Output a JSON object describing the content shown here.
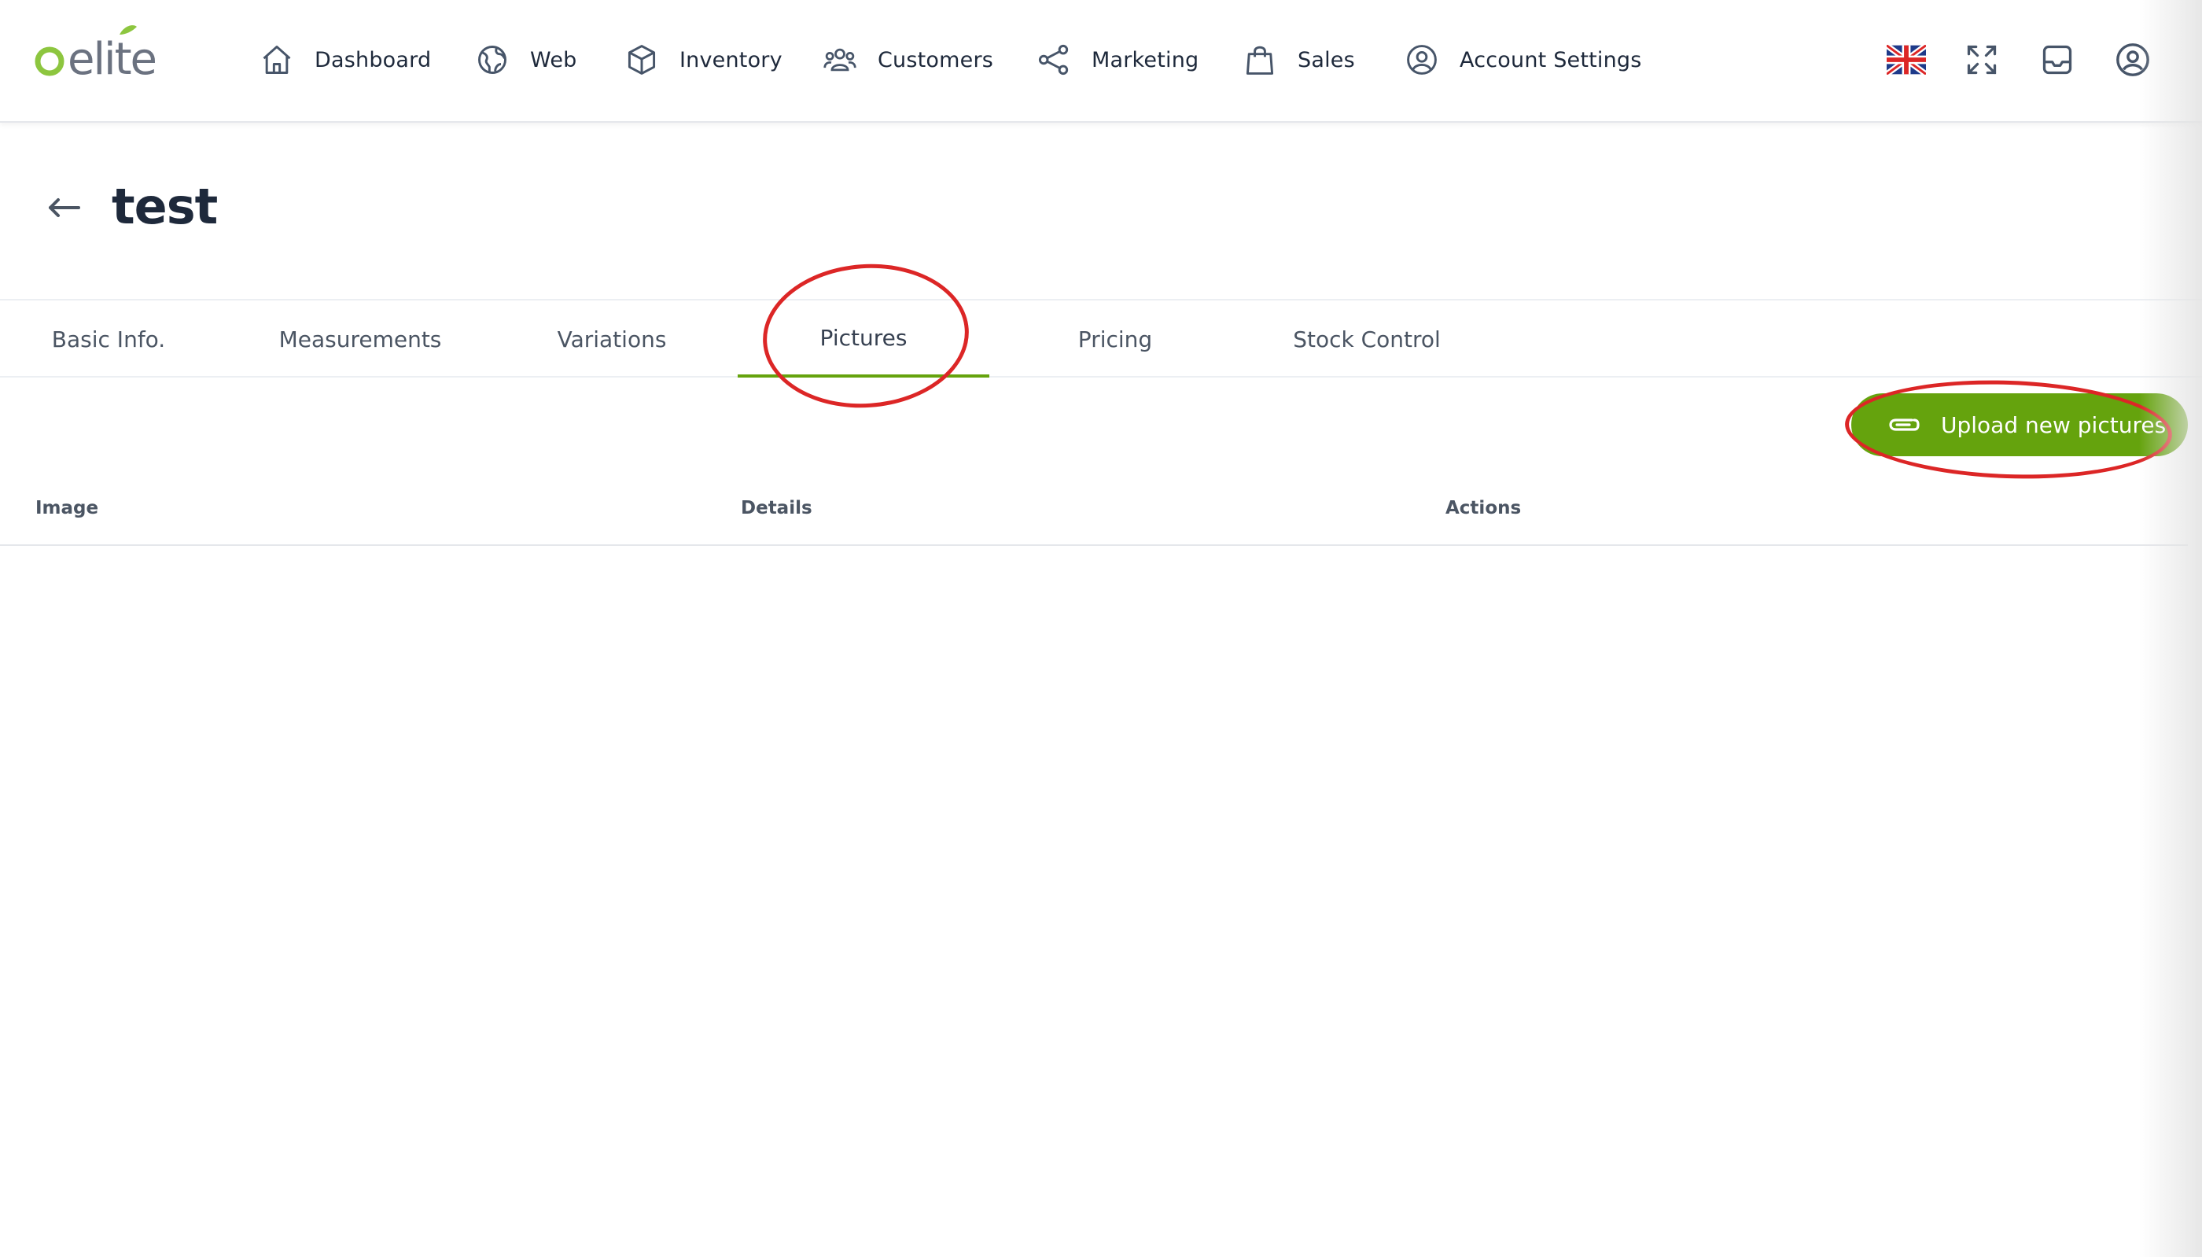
{
  "app": {
    "logo_text": "oelite",
    "brand_color": "#65a30d"
  },
  "nav": {
    "items": [
      {
        "label": "Dashboard",
        "icon": "home-icon"
      },
      {
        "label": "Web",
        "icon": "globe-icon"
      },
      {
        "label": "Inventory",
        "icon": "box-icon"
      },
      {
        "label": "Customers",
        "icon": "users-icon"
      },
      {
        "label": "Marketing",
        "icon": "share-icon"
      },
      {
        "label": "Sales",
        "icon": "shopping-bag-icon"
      },
      {
        "label": "Account Settings",
        "icon": "user-circle-icon"
      }
    ],
    "right_icons": [
      "uk-flag-icon",
      "fullscreen-icon",
      "inbox-icon",
      "profile-icon"
    ]
  },
  "page": {
    "title": "test",
    "back_icon": "arrow-left-icon"
  },
  "tabs": {
    "items": [
      "Basic Info.",
      "Measurements",
      "Variations",
      "Pictures",
      "Pricing",
      "Stock Control"
    ],
    "active": "Pictures"
  },
  "upload": {
    "label": "Upload new pictures",
    "icon": "paperclip-icon"
  },
  "table": {
    "columns": [
      "Image",
      "Details",
      "Actions"
    ],
    "rows": []
  },
  "annotations": {
    "color": "#dc2626",
    "targets": [
      "Pictures tab",
      "Upload new pictures button"
    ]
  }
}
